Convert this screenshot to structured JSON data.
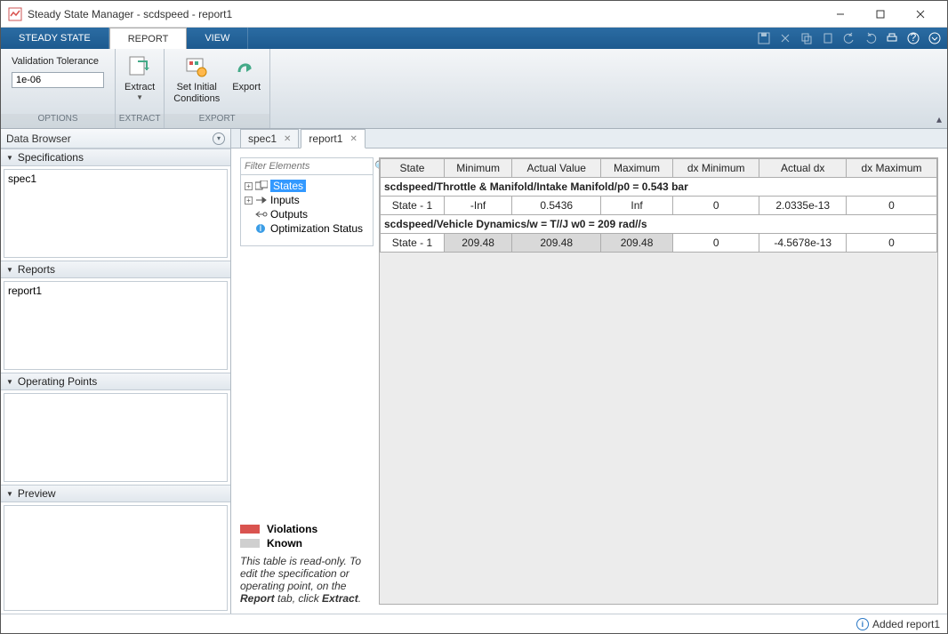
{
  "title": "Steady State Manager - scdspeed - report1",
  "tabs": {
    "steady_state": "STEADY STATE",
    "report": "REPORT",
    "view": "VIEW"
  },
  "toolstrip": {
    "options_label": "OPTIONS",
    "extract_label": "EXTRACT",
    "export_label": "EXPORT",
    "validation_tolerance_label": "Validation Tolerance",
    "validation_tolerance_value": "1e-06",
    "extract_btn": "Extract",
    "set_initial_btn": "Set Initial\nConditions",
    "export_btn": "Export"
  },
  "sidebar": {
    "databrowser": "Data Browser",
    "specifications": "Specifications",
    "spec_item": "spec1",
    "reports": "Reports",
    "report_item": "report1",
    "oppoints": "Operating Points",
    "preview": "Preview"
  },
  "doc_tabs": {
    "spec1": "spec1",
    "report1": "report1"
  },
  "filter": {
    "placeholder": "Filter Elements"
  },
  "tree": {
    "states": "States",
    "inputs": "Inputs",
    "outputs": "Outputs",
    "optstatus": "Optimization Status"
  },
  "legend": {
    "violations": "Violations",
    "known": "Known",
    "note1": "This table is read-only. To edit the specification or operating point, on the ",
    "note2": "Report",
    "note3": " tab, click ",
    "note4": "Extract",
    "note5": "."
  },
  "table": {
    "headers": [
      "State",
      "Minimum",
      "Actual Value",
      "Maximum",
      "dx Minimum",
      "Actual dx",
      "dx Maximum"
    ],
    "group1": "scdspeed/Throttle & Manifold/Intake Manifold/p0 = 0.543 bar",
    "row1": [
      "State - 1",
      "-Inf",
      "0.5436",
      "Inf",
      "0",
      "2.0335e-13",
      "0"
    ],
    "group2": "scdspeed/Vehicle Dynamics/w = T//J w0 = 209 rad//s",
    "row2": [
      "State - 1",
      "209.48",
      "209.48",
      "209.48",
      "0",
      "-4.5678e-13",
      "0"
    ]
  },
  "status": "Added report1"
}
